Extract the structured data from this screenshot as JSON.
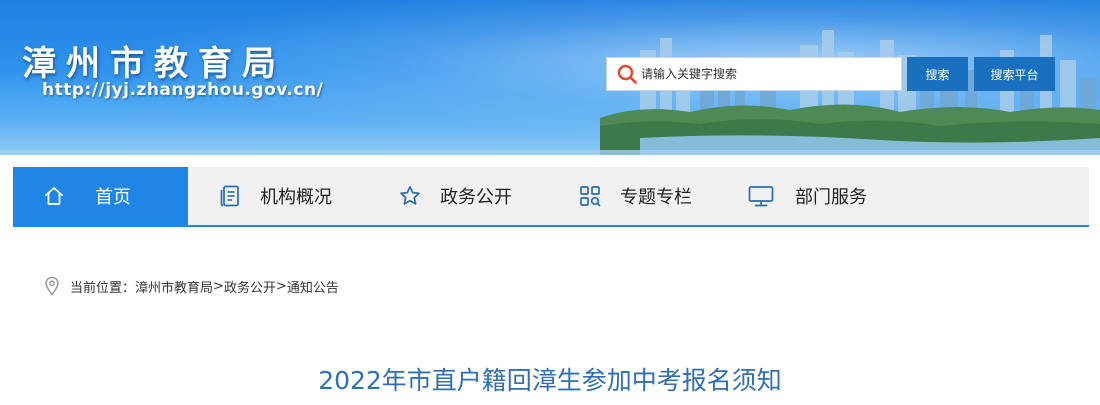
{
  "header": {
    "site_title": "漳州市教育局",
    "site_url": "http://jyj.zhangzhou.gov.cn/",
    "search": {
      "placeholder": "请输入关键字搜索",
      "value": ""
    },
    "search_button": "搜索",
    "platform_button": "搜索平台"
  },
  "nav": {
    "items": [
      {
        "label": "首页",
        "icon": "home-icon",
        "active": true
      },
      {
        "label": "机构概况",
        "icon": "document-list-icon",
        "active": false
      },
      {
        "label": "政务公开",
        "icon": "star-icon",
        "active": false
      },
      {
        "label": "专题专栏",
        "icon": "grid-search-icon",
        "active": false
      },
      {
        "label": "部门服务",
        "icon": "monitor-icon",
        "active": false
      }
    ]
  },
  "breadcrumb": {
    "prefix": "当前位置：",
    "items": [
      "漳州市教育局",
      "政务公开",
      "通知公告"
    ],
    "separator": ">"
  },
  "article": {
    "title": "2022年市直户籍回漳生参加中考报名须知"
  },
  "colors": {
    "accent": "#1f86e6",
    "button": "#1b6fbf",
    "title": "#2f6fb7",
    "nav_bg": "#f1f1f1",
    "search_icon": "#e8452c"
  }
}
